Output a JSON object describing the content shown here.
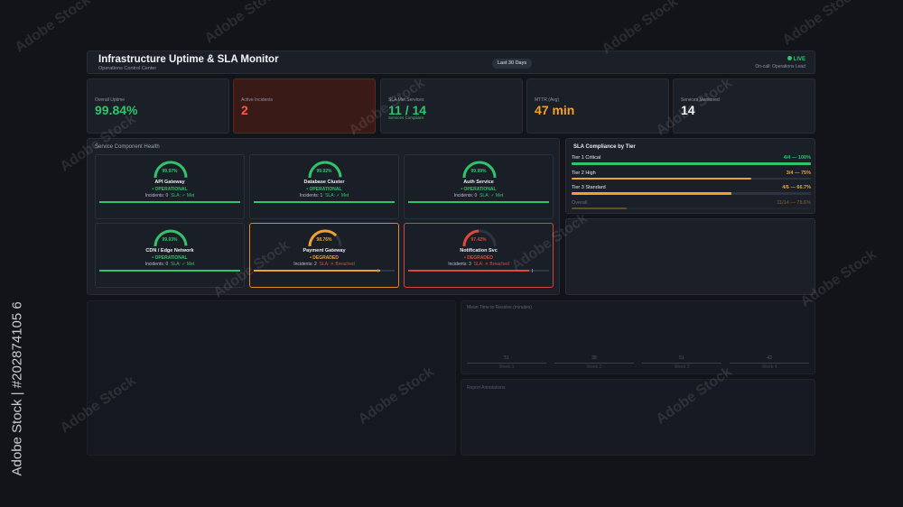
{
  "header": {
    "title": "Infrastructure Uptime & SLA Monitor",
    "subtitle": "Operations Control Center",
    "range": "Last 30 Days",
    "live": "LIVE",
    "oncall": "On-call: Operations Lead"
  },
  "kpis": [
    {
      "label": "Overall Uptime",
      "value": "99.84%",
      "color": "#2fc46b",
      "note": ""
    },
    {
      "label": "Active Incidents",
      "value": "2",
      "color": "#ff5a48",
      "note": ""
    },
    {
      "label": "SLA Met Services",
      "value": "11 / 14",
      "color": "#2fc46b",
      "note": "Services Compliant"
    },
    {
      "label": "MTTR (Avg)",
      "value": "47 min",
      "color": "#f2a12c",
      "note": ""
    },
    {
      "label": "Services Monitored",
      "value": "14",
      "color": "#f2f4f7",
      "note": ""
    }
  ],
  "health": {
    "title": "Service Component Health",
    "services": [
      {
        "pct": "99.97%",
        "uptime": 0.9997,
        "name": "API Gateway",
        "state": "• OPERATIONAL",
        "incidents": "Incidents: 0",
        "sla": "SLA: ✓ Met",
        "color": "#2fc46b"
      },
      {
        "pct": "99.92%",
        "uptime": 0.9992,
        "name": "Database Cluster",
        "state": "• OPERATIONAL",
        "incidents": "Incidents: 1",
        "sla": "SLA: ✓ Met",
        "color": "#2fc46b"
      },
      {
        "pct": "99.99%",
        "uptime": 0.9999,
        "name": "Auth Service",
        "state": "• OPERATIONAL",
        "incidents": "Incidents: 0",
        "sla": "SLA: ✓ Met",
        "color": "#2fc46b"
      },
      {
        "pct": "99.93%",
        "uptime": 0.9993,
        "name": "CDN / Edge Network",
        "state": "• OPERATIONAL",
        "incidents": "Incidents: 0",
        "sla": "SLA: ✓ Met",
        "color": "#2fc46b"
      },
      {
        "pct": "98.76%",
        "uptime": 0.9876,
        "name": "Payment Gateway",
        "state": "• DEGRADED",
        "incidents": "Incidents: 2",
        "sla": "SLA: ✕ Breached",
        "color": "#f2a12c"
      },
      {
        "pct": "97.42%",
        "uptime": 0.9742,
        "name": "Notification Svc",
        "state": "• DEGRADED",
        "incidents": "Incidents: 3",
        "sla": "SLA: ✕ Breached",
        "color": "#e0483c"
      }
    ]
  },
  "compliance": {
    "title": "SLA Compliance by Tier",
    "tiers": [
      {
        "label": "Tier 1 Critical",
        "value": "4/4 — 100%",
        "fraction": 1.0,
        "color": "#2fc46b"
      },
      {
        "label": "Tier 2 High",
        "value": "3/4 — 75%",
        "fraction": 0.75,
        "color": "#f2a12c"
      },
      {
        "label": "Tier 3 Standard",
        "value": "4/6 — 66.7%",
        "fraction": 0.667,
        "color": "#f2a12c"
      },
      {
        "label": "Overall",
        "value": "11/14 — 78.6%",
        "fraction": 0.786,
        "color": "#f2a12c"
      }
    ]
  },
  "mttr": {
    "title": "Mean Time to Resolve (minutes)",
    "weeks": [
      {
        "label": "Week 1",
        "value": "51"
      },
      {
        "label": "Week 2",
        "value": "38"
      },
      {
        "label": "Week 3",
        "value": "51"
      },
      {
        "label": "Week 4",
        "value": "42"
      }
    ]
  },
  "recs": {
    "title": "Report Annotations"
  },
  "watermark": {
    "text": "Adobe Stock",
    "id": "Adobe Stock | #202874105 6"
  }
}
